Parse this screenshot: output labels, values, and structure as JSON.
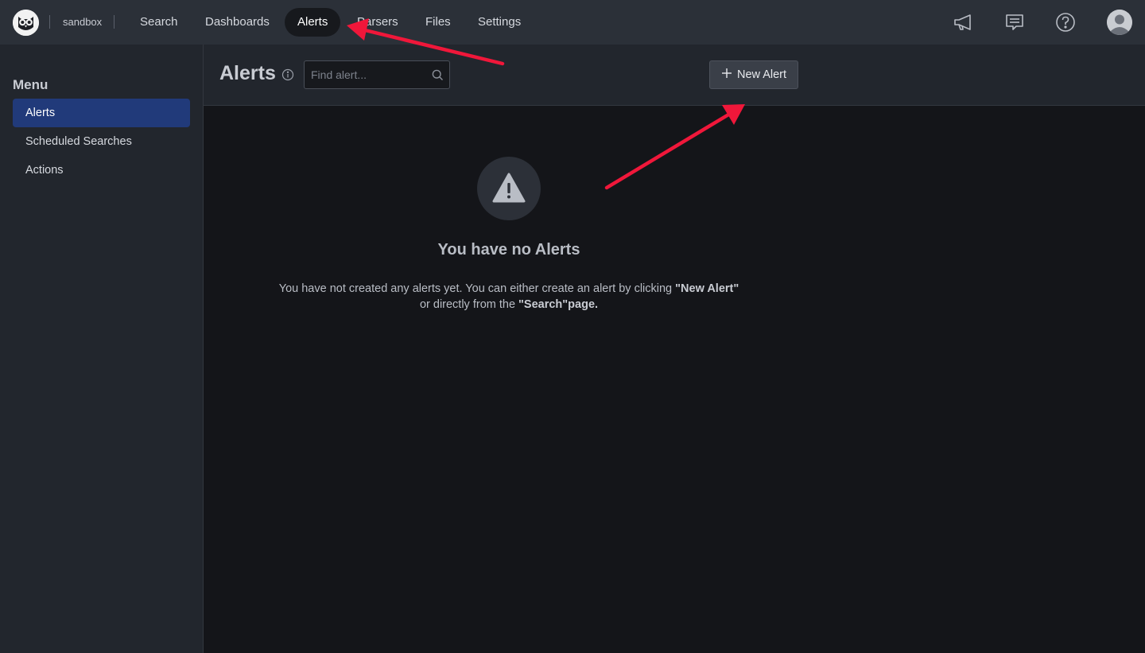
{
  "app": {
    "workspace": "sandbox"
  },
  "nav": {
    "items": [
      {
        "label": "Search"
      },
      {
        "label": "Dashboards"
      },
      {
        "label": "Alerts"
      },
      {
        "label": "Parsers"
      },
      {
        "label": "Files"
      },
      {
        "label": "Settings"
      }
    ],
    "active": "Alerts"
  },
  "topbar_icons": [
    "megaphone-icon",
    "chat-icon",
    "help-icon",
    "user-avatar-icon"
  ],
  "sidebar": {
    "title": "Menu",
    "items": [
      {
        "label": "Alerts"
      },
      {
        "label": "Scheduled Searches"
      },
      {
        "label": "Actions"
      }
    ],
    "active": "Alerts"
  },
  "header": {
    "title": "Alerts",
    "search_placeholder": "Find alert...",
    "new_button": "New Alert"
  },
  "empty_state": {
    "icon": "warning-icon",
    "title": "You have no Alerts",
    "text_part1": "You have not created any alerts yet. You can either create an alert by clicking ",
    "text_bold1": "\"New Alert\"",
    "text_part2": "or directly from the ",
    "text_bold2": "\"Search\"page."
  },
  "colors": {
    "topbar_bg": "#2b3038",
    "sidebar_bg": "#22262d",
    "main_bg": "#141519",
    "active_menu_bg": "#213a7a",
    "annotation_arrow": "#f0173a"
  }
}
